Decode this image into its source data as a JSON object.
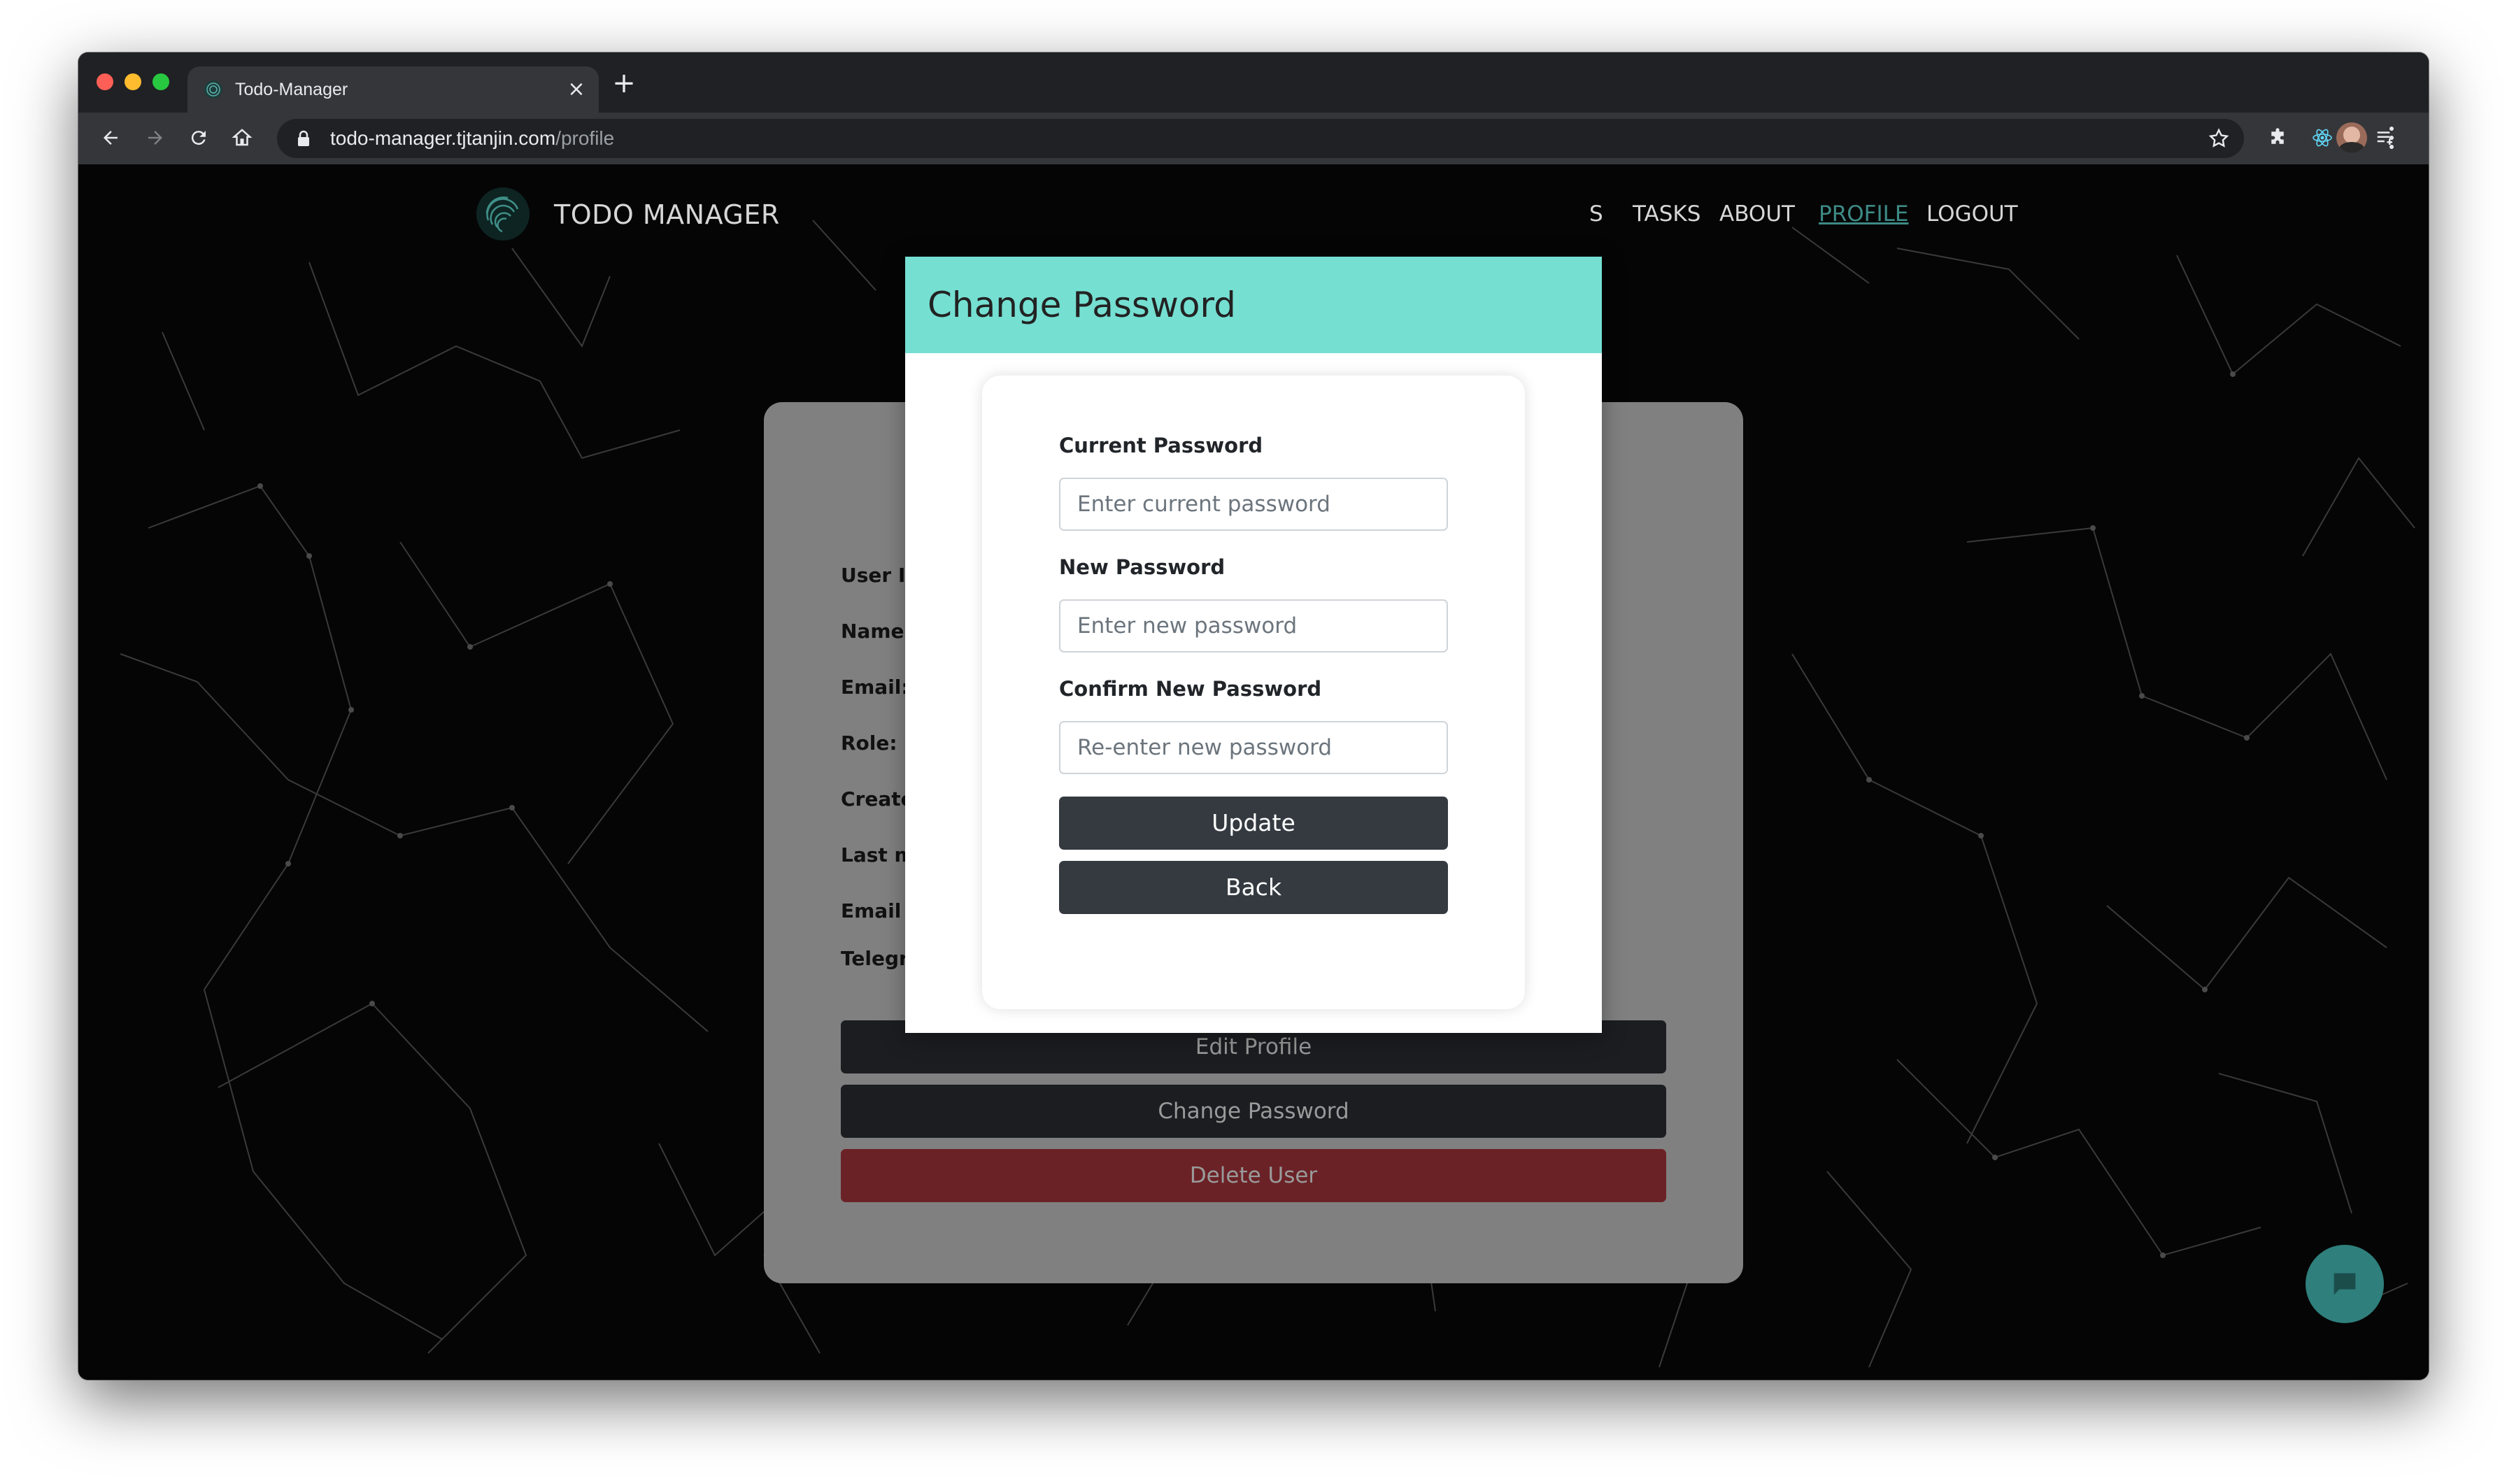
{
  "browser": {
    "tab_title": "Todo-Manager",
    "tab_close": "×",
    "new_tab": "+",
    "url_host": "todo-manager.tjtanjin.com",
    "url_path": "/profile",
    "traffic_colors": [
      "#ff5f57",
      "#febc2e",
      "#28c840"
    ]
  },
  "nav": {
    "brand": "TODO MANAGER",
    "items": [
      {
        "label": "S",
        "active": false
      },
      {
        "label": "TASKS",
        "active": false
      },
      {
        "label": "ABOUT",
        "active": false
      },
      {
        "label": "PROFILE",
        "active": true
      },
      {
        "label": "LOGOUT",
        "active": false
      }
    ]
  },
  "profile": {
    "fields": [
      "User II",
      "Name:",
      "Email:",
      "Role:",
      "Create",
      "Last m",
      "Email I",
      "Telegr"
    ],
    "buttons": {
      "edit": "Edit Profile",
      "change_password": "Change Password",
      "delete": "Delete User"
    }
  },
  "modal": {
    "title": "Change Password",
    "current_label": "Current Password",
    "current_placeholder": "Enter current password",
    "new_label": "New Password",
    "new_placeholder": "Enter new password",
    "confirm_label": "Confirm New Password",
    "confirm_placeholder": "Re-enter new password",
    "update_button": "Update",
    "back_button": "Back"
  },
  "colors": {
    "modal_header": "#75dfd2",
    "dark_button": "#343a40",
    "delete_button": "#6b2226",
    "accent_link": "#3d8a86",
    "chat_button": "#2f7f7c"
  }
}
